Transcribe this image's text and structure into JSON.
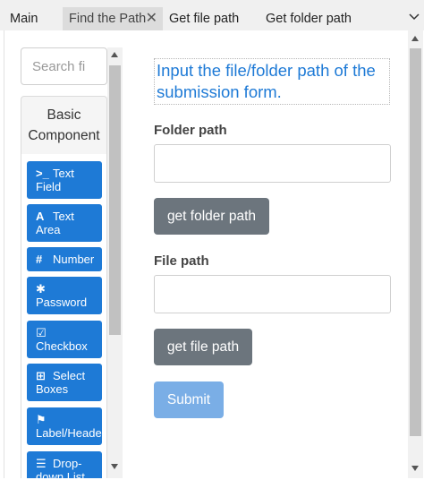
{
  "tabs": [
    {
      "label": "Main"
    },
    {
      "label": "Find the Path",
      "close": "✕"
    },
    {
      "label": "Get file path"
    },
    {
      "label": "Get folder path"
    }
  ],
  "sidebar": {
    "search_placeholder": "Search fi",
    "group_title_1": "Basic",
    "group_title_2": "Component",
    "items": [
      {
        "icon": ">_",
        "line1": "Text",
        "line2": "Field"
      },
      {
        "icon": "A",
        "line1": "Text",
        "line2": "Area"
      },
      {
        "icon": "#",
        "line1": "Number",
        "line2": ""
      },
      {
        "icon": "✱",
        "line1": "",
        "line2": "Password"
      },
      {
        "icon": "☑",
        "line1": "",
        "line2": "Checkbox"
      },
      {
        "icon": "⊞",
        "line1": "Select",
        "line2": "Boxes"
      },
      {
        "icon": "⚑",
        "line1": "",
        "line2": "Label/Header"
      },
      {
        "icon": "☰",
        "line1": "Drop-",
        "line2": "down List"
      }
    ]
  },
  "form": {
    "instruction": "Input the file/folder path of the submission form.",
    "folder_label": "Folder path",
    "folder_value": "",
    "folder_button": "get folder path",
    "file_label": "File path",
    "file_value": "",
    "file_button": "get file path",
    "submit": "Submit"
  },
  "colors": {
    "accent": "#1e7ad6",
    "secondary_button": "#6c757d",
    "submit_disabled": "#7aaee6"
  }
}
